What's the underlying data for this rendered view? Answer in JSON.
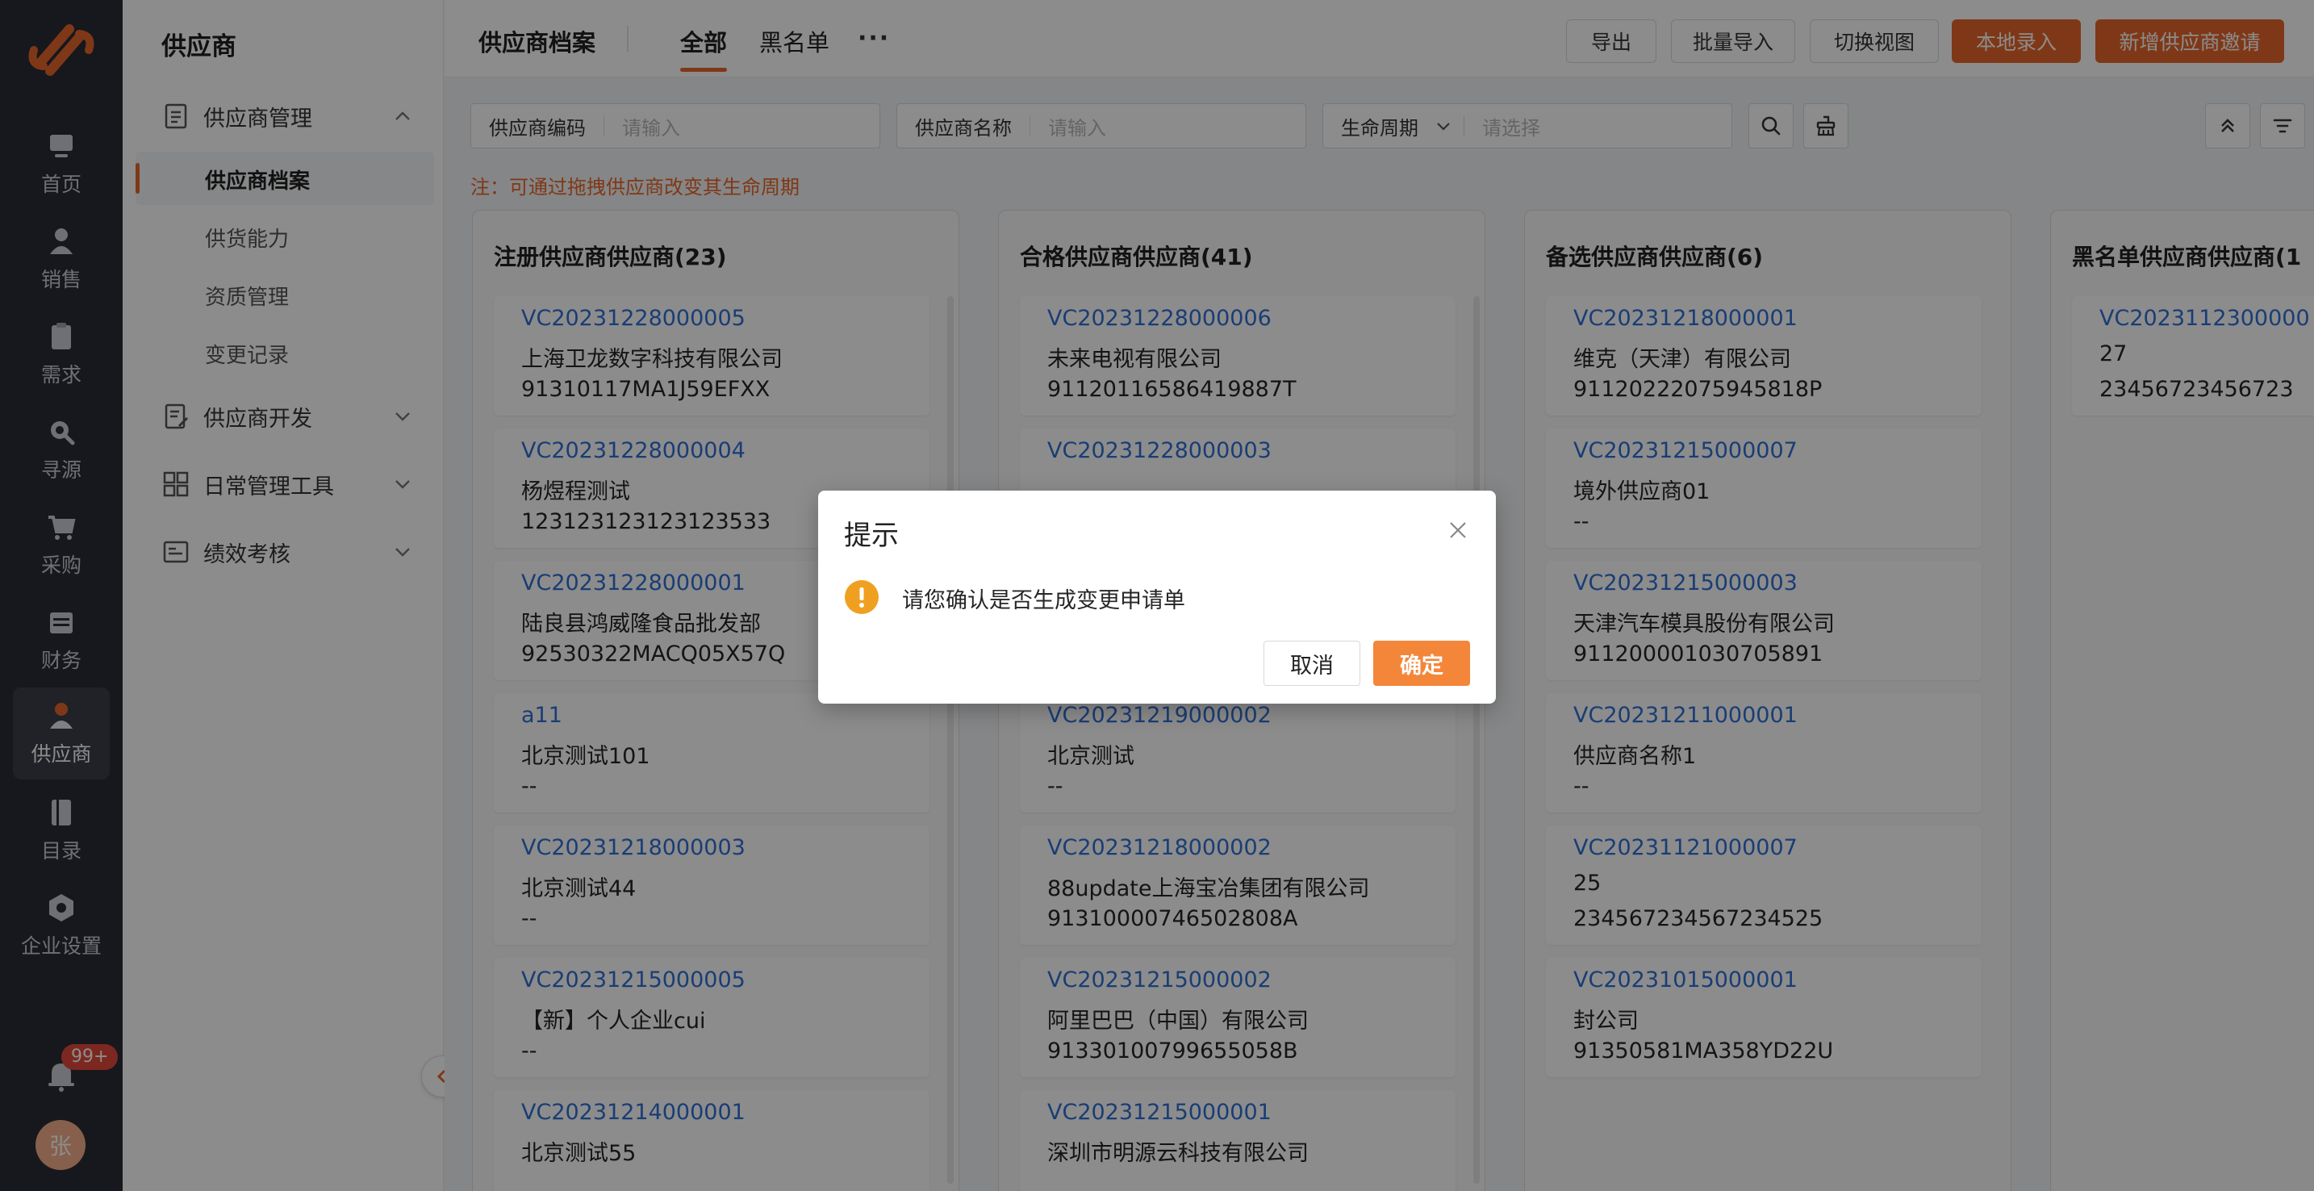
{
  "rail": {
    "items": [
      {
        "label": "首页",
        "icon": "monitor-icon"
      },
      {
        "label": "销售",
        "icon": "person-icon"
      },
      {
        "label": "需求",
        "icon": "clipboard-icon"
      },
      {
        "label": "寻源",
        "icon": "search-icon"
      },
      {
        "label": "采购",
        "icon": "cart-icon"
      },
      {
        "label": "财务",
        "icon": "wallet-icon"
      },
      {
        "label": "供应商",
        "icon": "supplier-icon"
      },
      {
        "label": "目录",
        "icon": "book-icon"
      },
      {
        "label": "企业设置",
        "icon": "hexagon-gear-icon"
      }
    ],
    "active": "供应商",
    "badge": "99+",
    "avatar": "张"
  },
  "sidebar": {
    "title": "供应商",
    "groups": [
      {
        "label": "供应商管理",
        "expanded": true,
        "items": [
          "供应商档案",
          "供货能力",
          "资质管理",
          "变更记录"
        ]
      },
      {
        "label": "供应商开发",
        "expanded": false
      },
      {
        "label": "日常管理工具",
        "expanded": false
      },
      {
        "label": "绩效考核",
        "expanded": false
      }
    ],
    "active_item": "供应商档案"
  },
  "header": {
    "breadcrumb": "供应商档案",
    "tabs": [
      "全部",
      "黑名单"
    ],
    "active_tab": "全部",
    "more": "···",
    "buttons": {
      "export": "导出",
      "batch_import": "批量导入",
      "switch_view": "切换视图",
      "local_entry": "本地录入",
      "invite": "新增供应商邀请"
    }
  },
  "filters": {
    "code": {
      "label": "供应商编码",
      "placeholder": "请输入"
    },
    "name": {
      "label": "供应商名称",
      "placeholder": "请输入"
    },
    "lifecycle": {
      "label": "生命周期",
      "placeholder": "请选择"
    }
  },
  "note": "注：可通过拖拽供应商改变其生命周期",
  "columns": [
    {
      "title": "注册供应商供应商(23)",
      "cards": [
        {
          "code": "VC20231228000005",
          "name": "上海卫龙数字科技有限公司",
          "tax": "91310117MA1J59EFXX"
        },
        {
          "code": "VC20231228000004",
          "name": "杨煜程测试",
          "tax": "123123123123123533"
        },
        {
          "code": "VC20231228000001",
          "name": "陆良县鸿威隆食品批发部",
          "tax": "92530322MACQ05X57Q"
        },
        {
          "code": "a11",
          "name": "北京测试101",
          "tax": "--"
        },
        {
          "code": "VC20231218000003",
          "name": "北京测试44",
          "tax": "--"
        },
        {
          "code": "VC20231215000005",
          "name": "【新】个人企业cui",
          "tax": "--"
        },
        {
          "code": "VC20231214000001",
          "name": "北京测试55",
          "tax": ""
        }
      ]
    },
    {
      "title": "合格供应商供应商(41)",
      "cards": [
        {
          "code": "VC20231228000006",
          "name": "未来电视有限公司",
          "tax": "91120116586419887T"
        },
        {
          "code": "VC20231228000003",
          "name": "",
          "tax": ""
        },
        {
          "code": "",
          "name": "",
          "tax": ""
        },
        {
          "code": "VC20231219000002",
          "name": "北京测试",
          "tax": "--"
        },
        {
          "code": "VC20231218000002",
          "name": "88update上海宝冶集团有限公司",
          "tax": "91310000746502808A"
        },
        {
          "code": "VC20231215000002",
          "name": "阿里巴巴（中国）有限公司",
          "tax": "91330100799655058B"
        },
        {
          "code": "VC20231215000001",
          "name": "深圳市明源云科技有限公司",
          "tax": ""
        }
      ]
    },
    {
      "title": "备选供应商供应商(6)",
      "cards": [
        {
          "code": "VC20231218000001",
          "name": "维克（天津）有限公司",
          "tax": "91120222075945818P"
        },
        {
          "code": "VC20231215000007",
          "name": "境外供应商01",
          "tax": "--"
        },
        {
          "code": "VC20231215000003",
          "name": "天津汽车模具股份有限公司",
          "tax": "911200001030705891"
        },
        {
          "code": "VC20231211000001",
          "name": "供应商名称1",
          "tax": "--"
        },
        {
          "code": "VC20231121000007",
          "name": "25",
          "tax": "234567234567234525"
        },
        {
          "code": "VC20231015000001",
          "name": "封公司",
          "tax": "91350581MA358YD22U"
        }
      ]
    },
    {
      "title": "黑名单供应商供应商(1",
      "cards": [
        {
          "code": "VC2023112300000",
          "name": "27",
          "tax": "23456723456723"
        }
      ]
    }
  ],
  "dialog": {
    "title": "提示",
    "message": "请您确认是否生成变更申请单",
    "cancel": "取消",
    "confirm": "确定",
    "icon": "warning-icon"
  },
  "colors": {
    "accent": "#e8672a",
    "link": "#2f6fd6",
    "rail_bg": "#2a2d35",
    "warning": "#f0a020",
    "confirm_btn": "#f4863a"
  }
}
